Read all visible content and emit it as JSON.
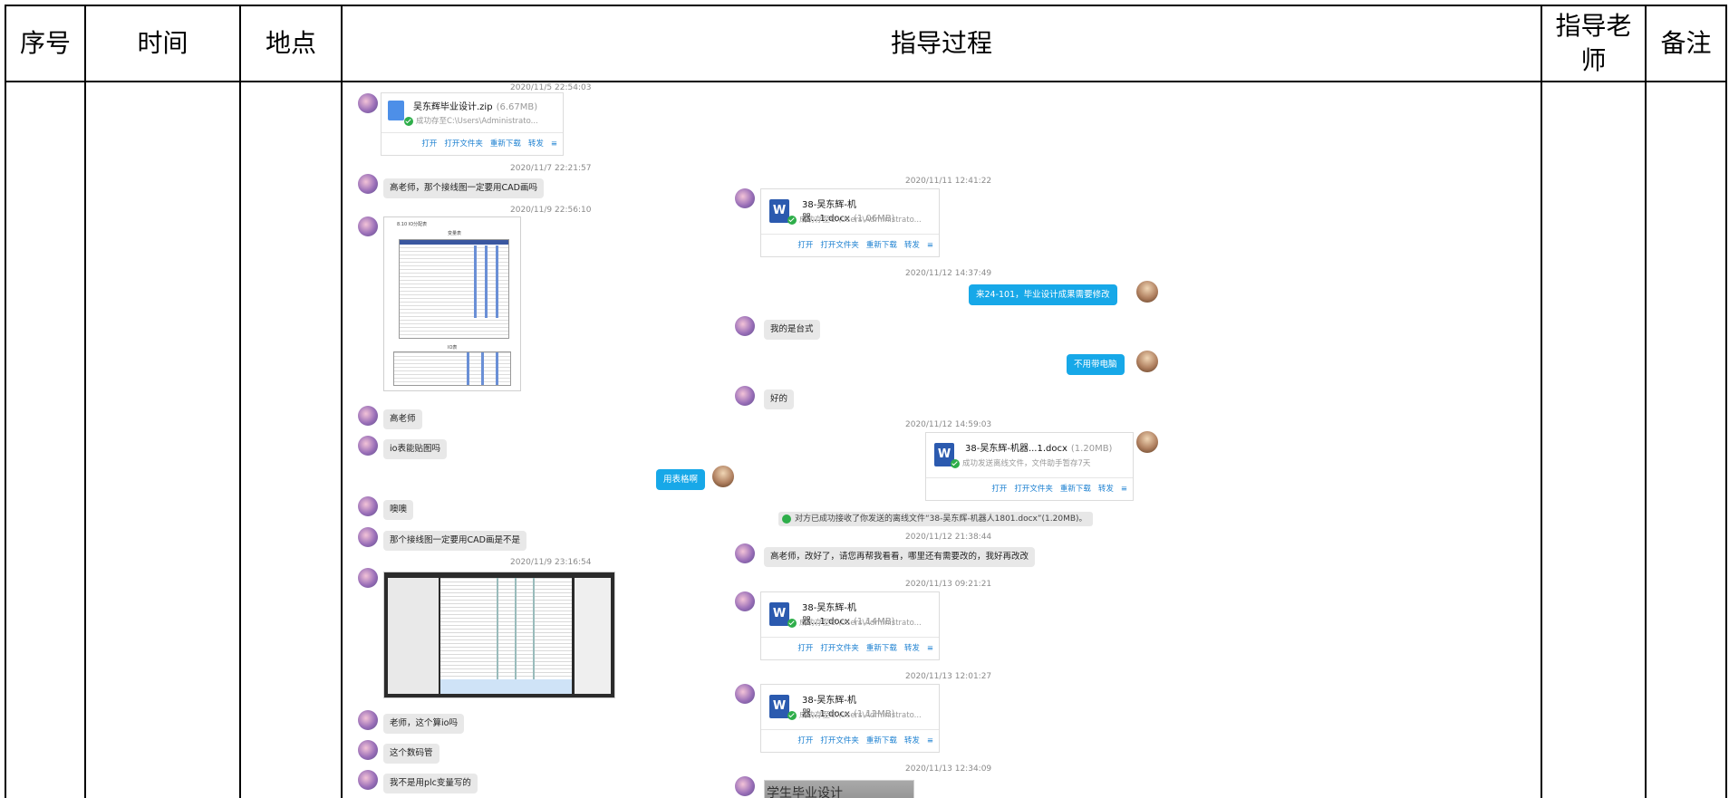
{
  "table": {
    "headers": {
      "seq": "序号",
      "time": "时间",
      "place": "地点",
      "process": "指导过程",
      "teacher_line1": "指导老",
      "teacher_line2": "师",
      "notes": "备注"
    }
  },
  "chat_left": {
    "ts1": "2020/11/5 22:54:03",
    "file1_name": "吴东辉毕业设计.zip",
    "file1_size": "(6.67MB)",
    "file1_status": "成功存至C:\\Users\\Administrato...",
    "ts2": "2020/11/7 22:21:57",
    "msg1": "高老师，那个接线图一定要用CAD画吗",
    "ts3": "2020/11/9 22:56:10",
    "msg2": "高老师",
    "msg3": "io表能贴图吗",
    "msg_self1": "用表格啊",
    "msg4": "噢噢",
    "msg5": "那个接线图一定要用CAD画是不是",
    "ts4": "2020/11/9 23:16:54",
    "msg6": "老师，这个算io吗",
    "msg7": "这个数码管",
    "msg8": "我不是用plc变量写的"
  },
  "chat_right": {
    "ts1": "2020/11/11 12:41:22",
    "file1_name": "38-吴东辉-机器...1.docx",
    "file1_size": "(1.06MB)",
    "file1_status": "成功存至C:\\Users\\Administrato...",
    "ts2": "2020/11/12 14:37:49",
    "msg_self1": "来24-101，毕业设计成果需要修改",
    "msg1": "我的是台式",
    "msg_self2": "不用带电脑",
    "msg2": "好的",
    "ts3": "2020/11/12 14:59:03",
    "file2_name": "38-吴东辉-机器...1.docx",
    "file2_size": "(1.20MB)",
    "file2_status": "成功发送离线文件，文件助手暂存7天",
    "sys": "对方已成功接收了你发送的离线文件“38-吴东辉-机器人1801.docx”(1.20MB)。",
    "ts4": "2020/11/12 21:38:44",
    "msg3": "高老师，改好了，请您再帮我看看，哪里还有需要改的，我好再改改",
    "ts5": "2020/11/13 09:21:21",
    "file3_name": "38-吴东辉-机器...1.docx",
    "file3_size": "(1.14MB)",
    "file3_status": "成功存至C:\\Users\\Administrato...",
    "ts6": "2020/11/13 12:01:27",
    "file4_name": "38-吴东辉-机器...1.docx",
    "file4_size": "(1.12MB)",
    "file4_status": "成功存至C:\\Users\\Administrato...",
    "ts7": "2020/11/13 12:34:09",
    "img_caption": "学生毕业设计"
  },
  "file_actions": {
    "open": "打开",
    "open_folder": "打开文件夹",
    "redownload": "重新下载",
    "forward": "转发",
    "menu": "≡"
  },
  "doc_thumb": {
    "line1": "8.10 IO分配表",
    "line2": "变量表",
    "line3": "IO表"
  }
}
